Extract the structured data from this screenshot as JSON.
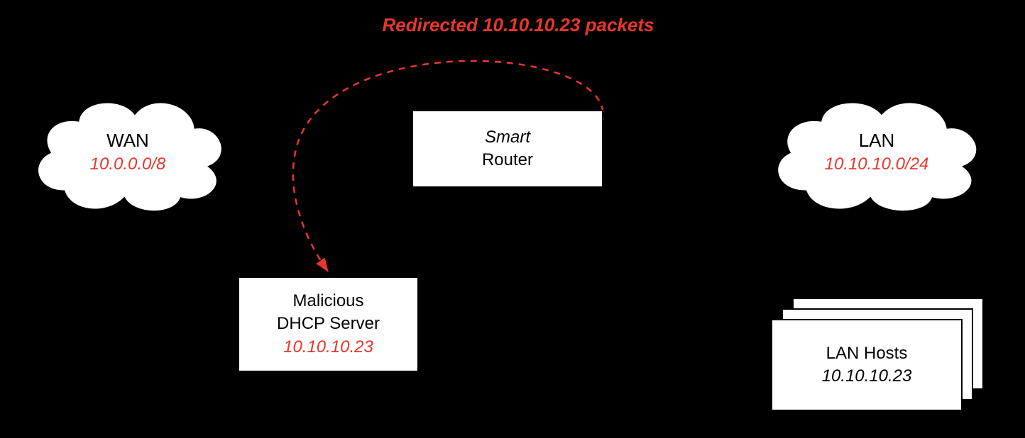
{
  "annotation": {
    "text": "Redirected 10.10.10.23 packets"
  },
  "wan": {
    "title": "WAN",
    "ip": "10.0.0.0/8"
  },
  "router": {
    "line1": "Smart",
    "line2": "Router"
  },
  "lan": {
    "title": "LAN",
    "ip": "10.10.10.0/24"
  },
  "dhcp": {
    "line1": "Malicious",
    "line2": "DHCP Server",
    "ip": "10.10.10.23"
  },
  "hosts": {
    "title": "LAN Hosts",
    "ip": "10.10.10.23"
  },
  "colors": {
    "accent": "#e8372a",
    "bg": "#000",
    "node": "#fff"
  }
}
